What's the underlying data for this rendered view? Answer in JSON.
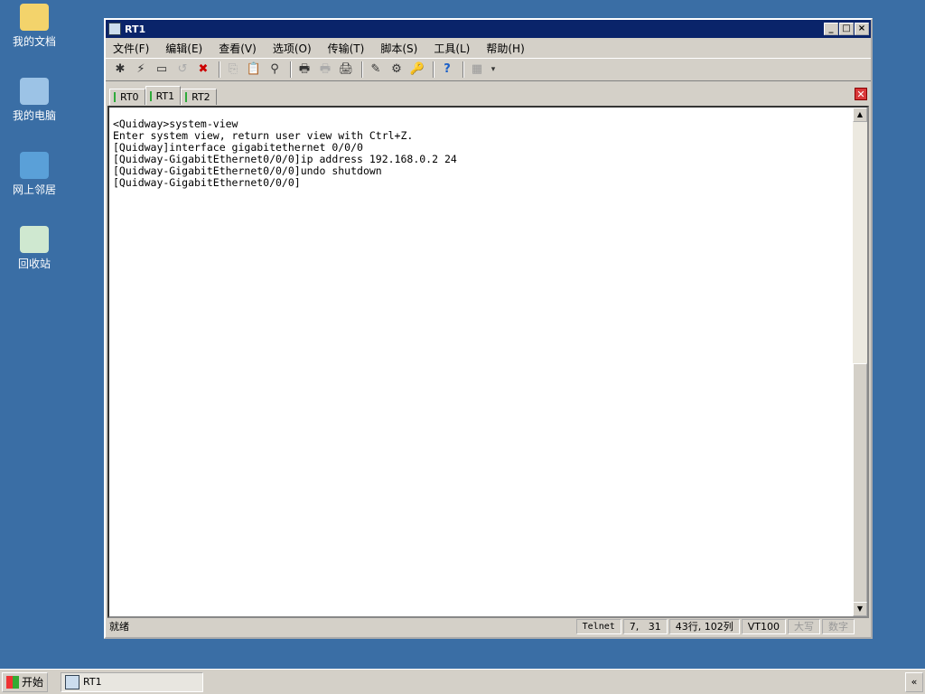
{
  "desktop": {
    "icons": [
      {
        "label": "我的文档"
      },
      {
        "label": "我的电脑"
      },
      {
        "label": "网上邻居"
      },
      {
        "label": "回收站"
      }
    ]
  },
  "window": {
    "title": "RT1",
    "controls": [
      "_",
      "□",
      "×"
    ]
  },
  "menu": [
    "文件(F)",
    "编辑(E)",
    "查看(V)",
    "选项(O)",
    "传输(T)",
    "脚本(S)",
    "工具(L)",
    "帮助(H)"
  ],
  "toolbar": {
    "icons": [
      "✱",
      "⚡",
      "▭",
      "↺",
      "✖",
      "|",
      "⎘",
      "📋",
      "⚲",
      "|",
      "🖶",
      "🖶",
      "🖨",
      "|",
      "✎",
      "⚙",
      "🔑",
      "|",
      "?",
      "|",
      "▦",
      "▾"
    ]
  },
  "tabs": [
    {
      "label": "RT0"
    },
    {
      "label": "RT1"
    },
    {
      "label": "RT2"
    }
  ],
  "terminal": {
    "text": "<Quidway>system-view\nEnter system view, return user view with Ctrl+Z.\n[Quidway]interface gigabitethernet 0/0/0\n[Quidway-GigabitEthernet0/0/0]ip address 192.168.0.2 24\n[Quidway-GigabitEthernet0/0/0]undo shutdown\n[Quidway-GigabitEthernet0/0/0]"
  },
  "status": {
    "ready": "就绪",
    "protocol": "Telnet",
    "cursor": "7,   31",
    "size": "43行, 102列",
    "emulation": "VT100",
    "caps": "大写",
    "num": "数字"
  },
  "taskbar": {
    "start": "开始",
    "task": "RT1",
    "tray": "«"
  }
}
